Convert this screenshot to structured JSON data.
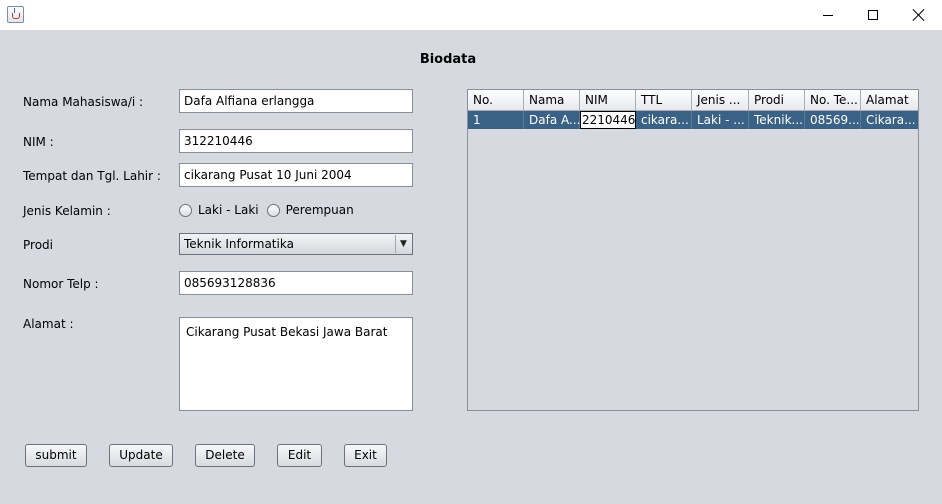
{
  "window": {
    "icon": "java-cup-icon",
    "controls": {
      "minimize": "minimize-icon",
      "maximize": "maximize-icon",
      "close": "close-icon"
    }
  },
  "form": {
    "title": "Biodata",
    "labels": {
      "nama": "Nama Mahasiswa/i   :",
      "nim": "NIM :",
      "ttl": "Tempat dan Tgl. Lahir :",
      "jenis_kelamin": "Jenis Kelamin :",
      "prodi": "Prodi",
      "telp": "Nomor Telp :",
      "alamat": "Alamat :"
    },
    "values": {
      "nama": "Dafa Alfiana erlangga",
      "nim": "312210446",
      "ttl": "cikarang Pusat 10 Juni 2004",
      "telp": "085693128836",
      "alamat": "Cikarang Pusat Bekasi Jawa Barat"
    },
    "gender_options": [
      "Laki - Laki",
      "Perempuan"
    ],
    "prodi_selected": "Teknik Informatika"
  },
  "table": {
    "columns": [
      "No.",
      "Nama",
      "NIM",
      "TTL",
      "Jenis ...",
      "Prodi",
      "No. Te...",
      "Alamat"
    ],
    "rows": [
      [
        "1",
        "Dafa A...",
        "2210446",
        "cikara...",
        "Laki - ...",
        "Teknik...",
        "08569...",
        "Cikara..."
      ]
    ]
  },
  "buttons": {
    "submit": "submit",
    "update": "Update",
    "delete": "Delete",
    "edit": "Edit",
    "exit": "Exit"
  }
}
